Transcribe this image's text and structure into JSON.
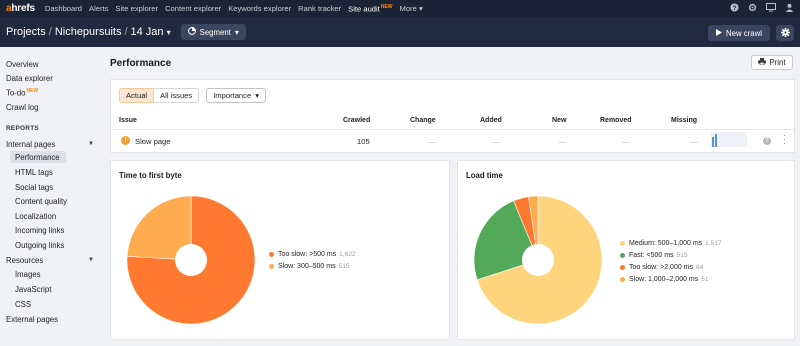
{
  "topnav": {
    "logo_a": "a",
    "logo_rest": "hrefs",
    "items": [
      {
        "label": "Dashboard"
      },
      {
        "label": "Alerts"
      },
      {
        "label": "Site explorer"
      },
      {
        "label": "Content explorer"
      },
      {
        "label": "Keywords explorer"
      },
      {
        "label": "Rank tracker"
      },
      {
        "label": "Site audit",
        "badge": "NEW"
      },
      {
        "label": "More"
      }
    ],
    "right_icons": [
      "help-icon",
      "settings-icon",
      "monitor-icon",
      "user-icon"
    ]
  },
  "header": {
    "crumbs": [
      "Projects",
      "Nichepursuits",
      "14 Jan"
    ],
    "segment_label": "Segment",
    "new_crawl_label": "New crawl"
  },
  "sidebar": {
    "overview": "Overview",
    "data_explorer": "Data explorer",
    "todo": "To-do",
    "todo_badge": "NEW",
    "crawl_log": "Crawl log",
    "reports_heading": "REPORTS",
    "internal_pages": "Internal pages",
    "internal_sub": [
      "Performance",
      "HTML tags",
      "Social tags",
      "Content quality",
      "Localization",
      "Incoming links",
      "Outgoing links"
    ],
    "resources": "Resources",
    "resources_sub": [
      "Images",
      "JavaScript",
      "CSS"
    ],
    "external_pages": "External pages"
  },
  "main": {
    "title": "Performance",
    "print_label": "Print",
    "filters": {
      "actual": "Actual",
      "all_issues": "All issues",
      "importance": "Importance"
    },
    "table": {
      "headers": [
        "Issue",
        "Crawled",
        "Change",
        "Added",
        "New",
        "Removed",
        "Missing"
      ],
      "rows": [
        {
          "issue": "Slow page",
          "crawled": "105",
          "change": "—",
          "added": "—",
          "new": "—",
          "removed": "—",
          "missing": "—"
        }
      ]
    }
  },
  "charts": {
    "ttfb": {
      "title": "Time to first byte",
      "legend": [
        {
          "label": "Too slow: >500 ms",
          "value": "1,622",
          "color": "#ff7a30"
        },
        {
          "label": "Slow: 300–500 ms",
          "value": "515",
          "color": "#ffab4f"
        }
      ]
    },
    "load": {
      "title": "Load time",
      "legend": [
        {
          "label": "Medium: 500–1,000 ms",
          "value": "1,517",
          "color": "#fed57d"
        },
        {
          "label": "Fast: <500 ms",
          "value": "515",
          "color": "#52a957"
        },
        {
          "label": "Too slow: >2,000 ms",
          "value": "84",
          "color": "#ff7a30"
        },
        {
          "label": "Slow: 1,000–2,000 ms",
          "value": "51",
          "color": "#ffab4f"
        }
      ]
    }
  },
  "chart_data": [
    {
      "type": "pie",
      "title": "Time to first byte",
      "categories": [
        "Too slow: >500 ms",
        "Slow: 300–500 ms"
      ],
      "values": [
        1622,
        515
      ],
      "colors": [
        "#ff7a30",
        "#ffab4f"
      ],
      "legend": "right"
    },
    {
      "type": "pie",
      "title": "Load time",
      "categories": [
        "Medium: 500–1,000 ms",
        "Fast: <500 ms",
        "Too slow: >2,000 ms",
        "Slow: 1,000–2,000 ms"
      ],
      "values": [
        1517,
        515,
        84,
        51
      ],
      "colors": [
        "#fed57d",
        "#52a957",
        "#ff7a30",
        "#ffab4f"
      ],
      "legend": "right"
    }
  ]
}
